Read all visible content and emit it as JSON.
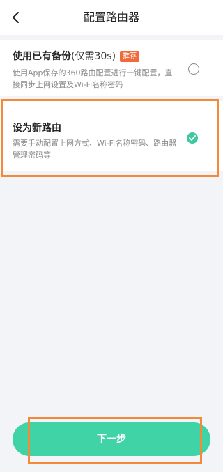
{
  "header": {
    "title": "配置路由器",
    "back_icon": "chevron-left-icon"
  },
  "options": [
    {
      "title": "使用已有备份",
      "subtitle": "(仅需30s)",
      "badge": "推荐",
      "description": "使用App保存的360路由配置进行一键配置，直接同步上网设置及Wi-Fi名称密码",
      "selected": false
    },
    {
      "title": "设为新路由",
      "description": "需要手动配置上网方式、Wi-Fi名称密码、路由器管理密码等",
      "selected": true
    }
  ],
  "footer": {
    "next_label": "下一步"
  },
  "colors": {
    "accent": "#3fd3a6",
    "badge": "#f06a3a",
    "highlight": "#f5893a"
  }
}
